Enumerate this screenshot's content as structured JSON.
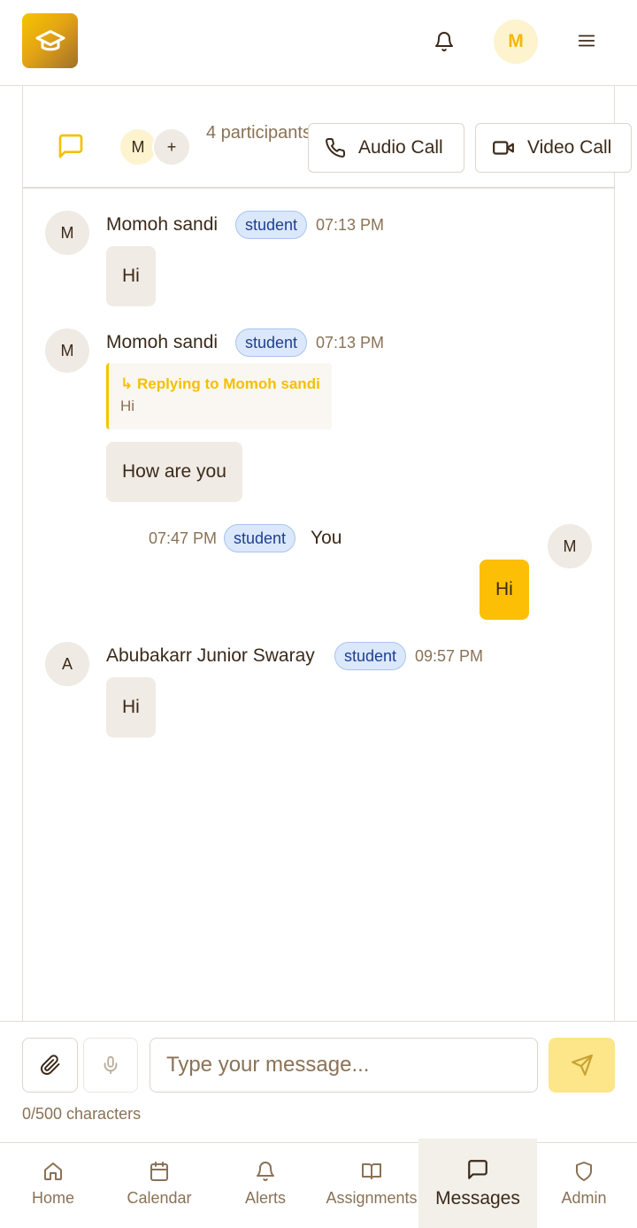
{
  "header": {
    "logo_icon": "graduation-cap-icon",
    "user_initial": "M"
  },
  "chat": {
    "participant_initial": "M",
    "participant_more": "+",
    "participants_label": "4 participants",
    "audio_call_label": "Audio Call",
    "video_call_label": "Video Call"
  },
  "messages": [
    {
      "avatar": "M",
      "name": "Momoh sandi",
      "role": "student",
      "time": "07:13 PM",
      "text": "Hi"
    },
    {
      "avatar": "M",
      "name": "Momoh sandi",
      "role": "student",
      "time": "07:13 PM",
      "reply_title": "↳ Replying to Momoh sandi",
      "reply_text": "Hi",
      "text": "How are you"
    },
    {
      "avatar": "M",
      "name": "You",
      "role": "student",
      "time": "07:47 PM",
      "text": "Hi",
      "own": true
    },
    {
      "avatar": "A",
      "name": "Abubakarr Junior Swaray",
      "role": "student",
      "time": "09:57 PM",
      "text": "Hi"
    }
  ],
  "composer": {
    "placeholder": "Type your message...",
    "char_count": "0/500 characters"
  },
  "nav": [
    {
      "label": "Home",
      "icon": "home-icon"
    },
    {
      "label": "Calendar",
      "icon": "calendar-icon"
    },
    {
      "label": "Alerts",
      "icon": "bell-icon"
    },
    {
      "label": "Assignments",
      "icon": "book-icon"
    },
    {
      "label": "Messages",
      "icon": "message-icon",
      "active": true
    },
    {
      "label": "Admin",
      "icon": "shield-icon"
    }
  ],
  "colors": {
    "accent": "#fdbf05",
    "badge_bg": "#dbe8fb",
    "text_muted": "#8a7256"
  }
}
